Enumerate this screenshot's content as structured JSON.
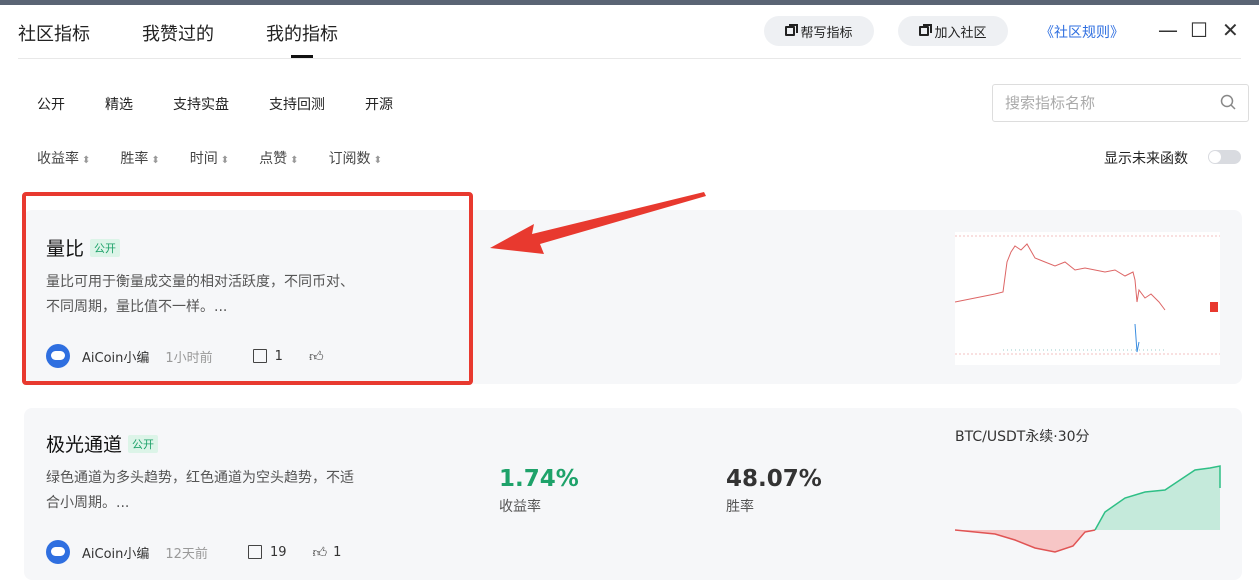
{
  "header": {
    "tabs": [
      {
        "label": "社区指标"
      },
      {
        "label": "我赞过的"
      },
      {
        "label": "我的指标"
      }
    ],
    "help_write": "帮写指标",
    "join_community": "加入社区",
    "rules_link": "《社区规则》",
    "minimize": "—",
    "maximize": "☐",
    "close": "✕"
  },
  "filters": [
    "公开",
    "精选",
    "支持实盘",
    "支持回测",
    "开源"
  ],
  "search": {
    "placeholder": "搜索指标名称"
  },
  "sorts": [
    "收益率",
    "胜率",
    "时间",
    "点赞",
    "订阅数"
  ],
  "future_toggle_label": "显示未来函数",
  "cards": [
    {
      "name": "量比",
      "badge": "公开",
      "desc": "量比可用于衡量成交量的相对活跃度，不同币对、不同周期，量比值不一样。...",
      "author": "AiCoin小编",
      "time": "1小时前",
      "subscribes": "1",
      "likes": ""
    },
    {
      "name": "极光通道",
      "badge": "公开",
      "desc": "绿色通道为多头趋势，红色通道为空头趋势，不适合小周期。...",
      "author": "AiCoin小编",
      "time": "12天前",
      "subscribes": "19",
      "likes": "1",
      "return_value": "1.74%",
      "return_label": "收益率",
      "winrate_value": "48.07%",
      "winrate_label": "胜率",
      "pair": "BTC/USDT永续·30分"
    }
  ],
  "colors": {
    "accent": "#2f6fe0",
    "green": "#1ea26a",
    "red": "#e8392f",
    "return": "#1ea26a"
  }
}
